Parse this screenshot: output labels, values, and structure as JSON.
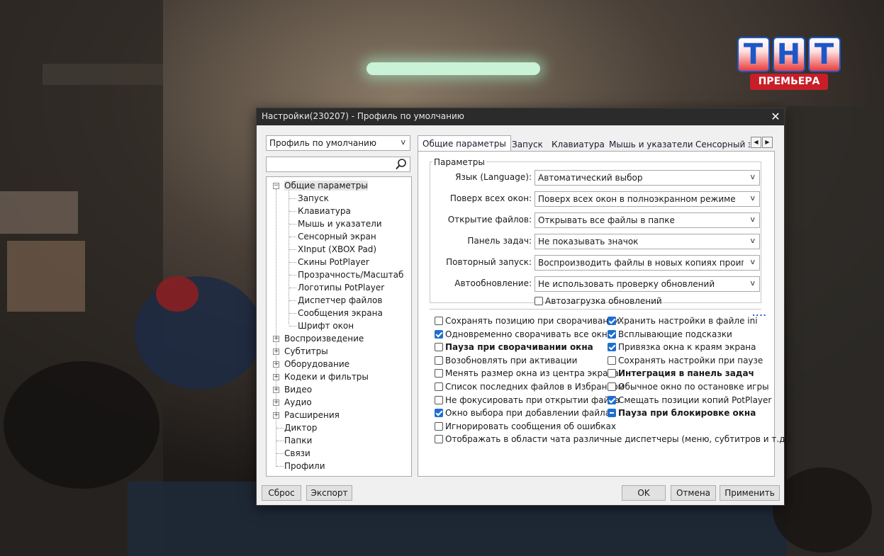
{
  "window": {
    "title": "Настройки(230207) - Профиль по умолчанию",
    "close_glyph": "✕"
  },
  "logo": {
    "letters": [
      "Т",
      "Н",
      "Т"
    ],
    "caption": "ПРЕМЬЕРА",
    "colors": {
      "blue": "#1b57c9",
      "red": "#c81e28"
    }
  },
  "profile_select": {
    "value": "Профиль по умолчанию"
  },
  "search": {
    "placeholder": ""
  },
  "tree": {
    "general": "Общие параметры",
    "general_children": [
      "Запуск",
      "Клавиатура",
      "Мышь и указатели",
      "Сенсорный экран",
      "XInput (XBOX Pad)",
      "Скины PotPlayer",
      "Прозрачность/Масштаб",
      "Логотипы PotPlayer",
      "Диспетчер файлов",
      "Сообщения экрана",
      "Шрифт окон"
    ],
    "collapsed": [
      "Воспроизведение",
      "Субтитры",
      "Оборудование",
      "Кодеки и фильтры",
      "Видео",
      "Аудио",
      "Расширения"
    ],
    "leaves": [
      "Диктор",
      "Папки",
      "Связи",
      "Профили"
    ]
  },
  "tabs": [
    "Общие параметры",
    "Запуск",
    "Клавиатура",
    "Мышь и указатели",
    "Сенсорный эк"
  ],
  "params": {
    "legend": "Параметры",
    "rows": [
      {
        "label": "Язык (Language):",
        "value": "Автоматический выбор"
      },
      {
        "label": "Поверх всех окон:",
        "value": "Поверх всех окон в полноэкранном режиме"
      },
      {
        "label": "Открытие файлов:",
        "value": "Открывать все файлы в папке"
      },
      {
        "label": "Панель задач:",
        "value": "Не показывать значок"
      },
      {
        "label": "Повторный запуск:",
        "value": "Воспроизводить файлы в новых копиях проигрыват"
      },
      {
        "label": "Автообновление:",
        "value": "Не использовать проверку обновлений"
      }
    ],
    "autoload": {
      "label": "Автозагрузка обновлений",
      "checked": false
    }
  },
  "options": {
    "more": "....",
    "left": [
      {
        "label": "Сохранять позицию при сворачивании",
        "state": "unchecked",
        "bold": false
      },
      {
        "label": "Одновременно сворачивать все окна",
        "state": "checked",
        "bold": false
      },
      {
        "label": "Пауза при сворачивании окна",
        "state": "unchecked",
        "bold": true
      },
      {
        "label": "Возобновлять при активации",
        "state": "unchecked",
        "bold": false
      },
      {
        "label": "Менять размер окна из центра экрана",
        "state": "unchecked",
        "bold": false
      },
      {
        "label": "Список последних файлов в Избранном",
        "state": "unchecked",
        "bold": false
      },
      {
        "label": "Не фокусировать при открытии файла",
        "state": "unchecked",
        "bold": false
      },
      {
        "label": "Окно выбора при добавлении файла",
        "state": "checked",
        "bold": false
      },
      {
        "label": "Игнорировать сообщения об ошибках",
        "state": "unchecked",
        "bold": false
      },
      {
        "label": "Отображать в области чата различные диспетчеры (меню, субтитров и т.д.)",
        "state": "unchecked",
        "bold": false
      }
    ],
    "right": [
      {
        "label": "Хранить настройки в файле ini",
        "state": "checked",
        "bold": false
      },
      {
        "label": "Всплывающие подсказки",
        "state": "checked",
        "bold": false
      },
      {
        "label": "Привязка окна к краям экрана",
        "state": "checked",
        "bold": false
      },
      {
        "label": "Сохранять настройки при паузе",
        "state": "unchecked",
        "bold": false
      },
      {
        "label": "Интеграция в панель задач",
        "state": "unchecked",
        "bold": true
      },
      {
        "label": "Обычное окно по остановке игры",
        "state": "unchecked",
        "bold": false
      },
      {
        "label": "Смещать позиции копий PotPlayer",
        "state": "checked",
        "bold": false
      },
      {
        "label": "Пауза при блокировке окна",
        "state": "indeterminate",
        "bold": true
      }
    ]
  },
  "buttons": {
    "reset": "Сброс",
    "export": "Экспорт",
    "ok": "OK",
    "cancel": "Отмена",
    "apply": "Применить"
  },
  "colors": {
    "accent": "#1e6fd1",
    "titlebar": "#2b2b2b",
    "dialog_bg": "#f0f0f0"
  }
}
